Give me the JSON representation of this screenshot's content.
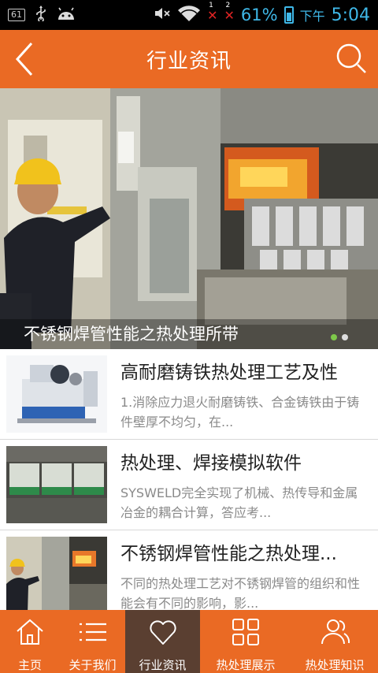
{
  "status_bar": {
    "badge": "61",
    "sim1": "1",
    "sim2": "2",
    "battery": "61%",
    "ampm": "下午",
    "time": "5:04",
    "icons": [
      "usb-icon",
      "android-icon",
      "mute-icon",
      "wifi-icon",
      "signal-icon",
      "battery-icon"
    ]
  },
  "header": {
    "title": "行业资讯",
    "back_icon": "chevron-left-icon",
    "search_icon": "search-icon"
  },
  "banner": {
    "caption": "不锈钢焊管性能之热处理所带",
    "slide_count": 2,
    "active_slide": 1
  },
  "news": [
    {
      "title": "高耐磨铸铁热处理工艺及性",
      "desc": "1.消除应力退火耐磨铸铁、合金铸铁由于铸件壁厚不均匀，在..."
    },
    {
      "title": "热处理、焊接模拟软件",
      "desc": "SYSWELD完全实现了机械、热传导和金属冶金的耦合计算，答应考..."
    },
    {
      "title": "不锈钢焊管性能之热处理...",
      "desc": "不同的热处理工艺对不锈钢焊管的组织和性能会有不同的影响，影..."
    }
  ],
  "nav": [
    {
      "label": "主页",
      "icon": "home-icon"
    },
    {
      "label": "关于我们",
      "icon": "menu-list-icon"
    },
    {
      "label": "行业资讯",
      "icon": "heart-icon",
      "active": true
    },
    {
      "label": "热处理展示",
      "icon": "grid-icon"
    },
    {
      "label": "热处理知识",
      "icon": "users-icon"
    }
  ],
  "colors": {
    "primary": "#ea6a24",
    "nav_active": "#5a3f31",
    "status_accent": "#3fb8e8"
  }
}
